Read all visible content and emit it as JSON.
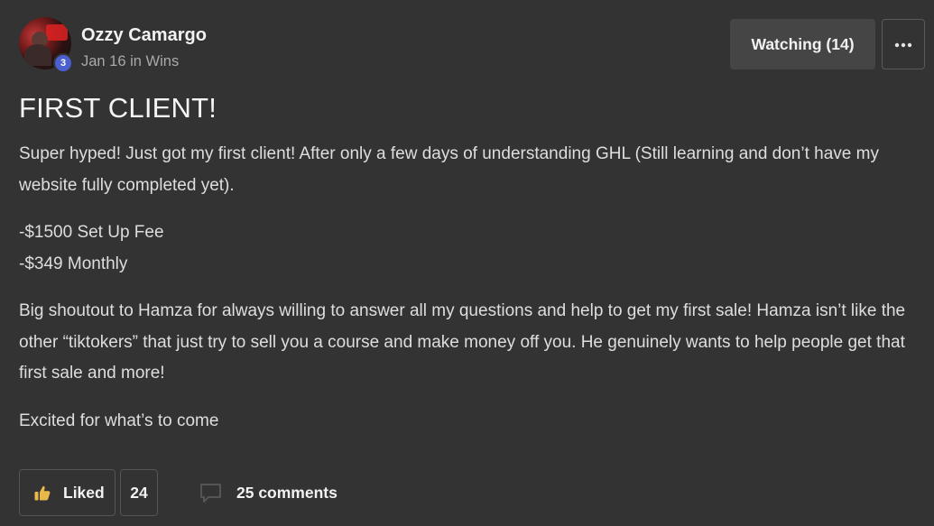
{
  "author": {
    "name": "Ozzy Camargo",
    "level": "3",
    "meta": "Jan 16 in Wins"
  },
  "header": {
    "watch_label": "Watching (14)",
    "more_label": "more-options"
  },
  "post": {
    "title": "FIRST CLIENT!",
    "paragraphs": [
      "Super hyped! Just got my first client! After only a few days of understanding GHL (Still learning and don’t have my website fully completed yet).",
      "-$1500 Set Up Fee",
      "-$349 Monthly",
      "Big shoutout to Hamza for always willing to answer all my questions and help to get my first sale! Hamza isn’t like the other “tiktokers” that just try to sell you a course and make money off you. He genuinely wants to help people get that first sale and more!",
      "Excited for what’s to come"
    ]
  },
  "footer": {
    "like_label": "Liked",
    "like_count": "24",
    "comments_label": "25 comments"
  },
  "colors": {
    "background": "#333333",
    "button_bg": "#454545",
    "accent_badge": "#4b5fd1",
    "thumb_icon": "#e8b84a"
  },
  "icons": {
    "more": "ellipsis-icon",
    "like": "thumbs-up-icon",
    "comment": "comment-bubble-icon"
  }
}
